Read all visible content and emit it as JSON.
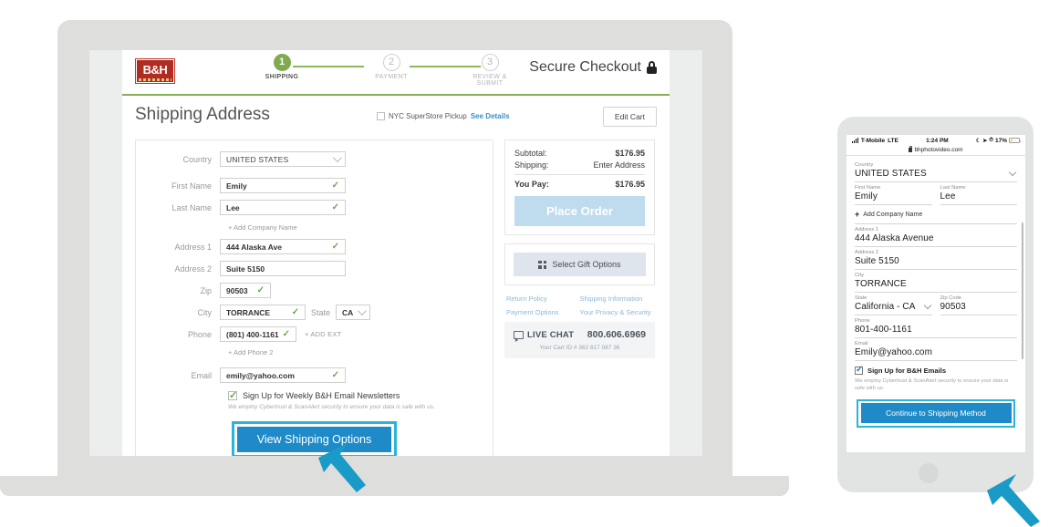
{
  "desktop": {
    "brand": {
      "logo_text": "B&H",
      "logo_sub": "PHOTO VIDEO AUDIO"
    },
    "header": {
      "secure_label": "Secure Checkout",
      "lock_icon": "lock-icon",
      "steps": [
        {
          "number": "1",
          "label": "SHIPPING",
          "state": "active"
        },
        {
          "number": "2",
          "label": "PAYMENT",
          "state": "idle"
        },
        {
          "number": "3",
          "label": "REVIEW & SUBMIT",
          "state": "idle"
        }
      ]
    },
    "title": "Shipping Address",
    "pickup": {
      "label": "NYC SuperStore Pickup",
      "link": "See Details",
      "checked": false
    },
    "edit_cart": "Edit Cart",
    "form": {
      "country": {
        "label": "Country",
        "value": "UNITED STATES"
      },
      "first_name": {
        "label": "First Name",
        "value": "Emily",
        "valid": "✓"
      },
      "last_name": {
        "label": "Last Name",
        "value": "Lee",
        "valid": "✓"
      },
      "add_company": "+ Add Company Name",
      "address1": {
        "label": "Address 1",
        "value": "444 Alaska Ave",
        "valid": "✓"
      },
      "address2": {
        "label": "Address 2",
        "value": "Suite 5150"
      },
      "zip": {
        "label": "Zip",
        "value": "90503",
        "valid": "✓"
      },
      "city": {
        "label": "City",
        "value": "TORRANCE",
        "valid": "✓"
      },
      "state": {
        "label": "State",
        "value": "CA"
      },
      "phone": {
        "label": "Phone",
        "value": "(801) 400-1161",
        "valid": "✓",
        "ext": "+ ADD EXT"
      },
      "add_phone2": "+ Add Phone 2",
      "email": {
        "label": "Email",
        "value": "emily@yahoo.com",
        "valid": "✓"
      },
      "newsletter": {
        "label": "Sign Up for Weekly B&H Email Newsletters",
        "checked": true
      },
      "disclaimer": "We employ Cybertrust & ScanAlert security to ensure your data is safe with us.",
      "submit": "View Shipping Options"
    },
    "summary": {
      "subtotal_label": "Subtotal:",
      "subtotal_value": "$176.95",
      "shipping_label": "Shipping:",
      "shipping_value": "Enter Address",
      "youpay_label": "You Pay:",
      "youpay_value": "$176.95",
      "place_order": "Place Order",
      "gift_options": "Select Gift Options",
      "gift_icon": "gift-grid-icon",
      "links": [
        "Return Policy",
        "Shipping Information",
        "Payment Options",
        "Your Privacy & Security"
      ],
      "chat_icon": "chat-bubble-icon",
      "chat_label": "LIVE CHAT",
      "chat_phone": "800.606.6969",
      "cart_id": "Your Cart ID # 362 817 087 36"
    }
  },
  "mobile": {
    "status": {
      "carrier": "T-Mobile",
      "network": "LTE",
      "time": "1:24 PM",
      "battery": "17%"
    },
    "url": "bhphotovideo.com",
    "form": {
      "country": {
        "label": "Country",
        "value": "UNITED STATES"
      },
      "first_name": {
        "label": "First Name",
        "value": "Emily"
      },
      "last_name": {
        "label": "Last Name",
        "value": "Lee"
      },
      "add_company": "Add Company Name",
      "address1": {
        "label": "Address 1",
        "value": "444 Alaska Avenue"
      },
      "address2": {
        "label": "Address 2",
        "value": "Suite 5150"
      },
      "city": {
        "label": "City",
        "value": "TORRANCE"
      },
      "state": {
        "label": "State",
        "value": "California - CA"
      },
      "zip": {
        "label": "Zip Code",
        "value": "90503"
      },
      "phone": {
        "label": "Phone",
        "value": "801-400-1161"
      },
      "email": {
        "label": "Email",
        "value": "Emily@yahoo.com"
      },
      "newsletter": {
        "label": "Sign Up for B&H Emails",
        "checked": true
      },
      "disclaimer": "We employ Cybertrust & ScanAlert security to ensure your data is safe with us.",
      "submit": "Continue to Shipping Method"
    }
  },
  "colors": {
    "accent_blue": "#1e8bc8",
    "highlight_cyan": "#29b4d9",
    "step_green": "#7fab4c",
    "brand_red": "#b02b21"
  }
}
